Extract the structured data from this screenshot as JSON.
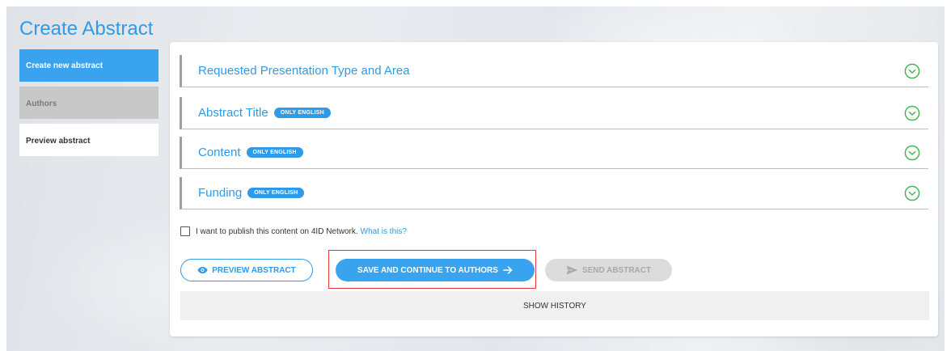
{
  "page": {
    "title": "Create Abstract"
  },
  "sidebar": {
    "items": [
      {
        "label": "Create new abstract",
        "state": "active"
      },
      {
        "label": "Authors",
        "state": "disabled"
      },
      {
        "label": "Preview abstract",
        "state": "normal"
      }
    ]
  },
  "sections": [
    {
      "title": "Requested Presentation Type and Area",
      "badge": ""
    },
    {
      "title": "Abstract Title",
      "badge": "ONLY ENGLISH"
    },
    {
      "title": "Content",
      "badge": "ONLY ENGLISH"
    },
    {
      "title": "Funding",
      "badge": "ONLY ENGLISH"
    }
  ],
  "publish": {
    "label": "I want to publish this content on 4ID Network.",
    "link": "What is this?",
    "checked": false
  },
  "actions": {
    "preview_label": "PREVIEW ABSTRACT",
    "save_label": "SAVE AND CONTINUE TO AUTHORS",
    "send_label": "SEND ABSTRACT",
    "history_label": "SHOW HISTORY"
  },
  "colors": {
    "accent": "#2e9ae8",
    "chevron": "#3bb34a",
    "highlight": "#e53935"
  },
  "icons": {
    "section_expand": "chevron-down-circle-icon",
    "preview": "eye-icon",
    "save": "arrow-right-icon",
    "send": "send-icon"
  }
}
